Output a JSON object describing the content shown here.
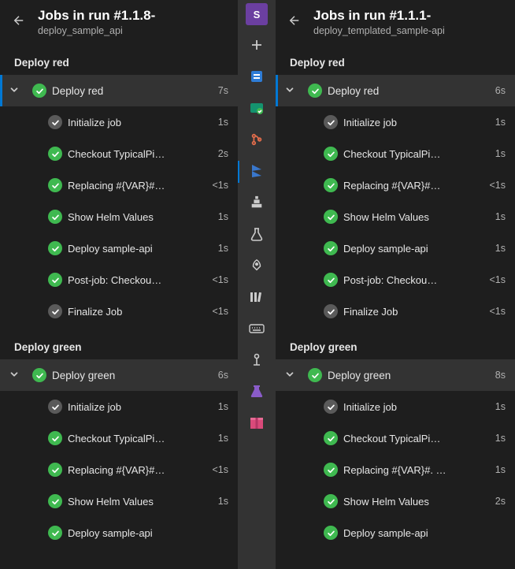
{
  "left": {
    "title": "Jobs in run #1.1.8-",
    "subtitle": "deploy_sample_api",
    "stages": [
      {
        "label": "Deploy red",
        "job": {
          "name": "Deploy red",
          "time": "7s",
          "status": "green",
          "selected": true
        },
        "steps": [
          {
            "name": "Initialize job",
            "time": "1s",
            "status": "grey"
          },
          {
            "name": "Checkout TypicalPi…",
            "time": "2s",
            "status": "green"
          },
          {
            "name": "Replacing #{VAR}#…",
            "time": "<1s",
            "status": "green"
          },
          {
            "name": "Show Helm Values",
            "time": "1s",
            "status": "green"
          },
          {
            "name": "Deploy sample-api",
            "time": "1s",
            "status": "green"
          },
          {
            "name": "Post-job: Checkou…",
            "time": "<1s",
            "status": "green"
          },
          {
            "name": "Finalize Job",
            "time": "<1s",
            "status": "grey"
          }
        ]
      },
      {
        "label": "Deploy green",
        "job": {
          "name": "Deploy green",
          "time": "6s",
          "status": "green",
          "selected": false
        },
        "steps": [
          {
            "name": "Initialize job",
            "time": "1s",
            "status": "grey"
          },
          {
            "name": "Checkout TypicalPi…",
            "time": "1s",
            "status": "green"
          },
          {
            "name": "Replacing #{VAR}#…",
            "time": "<1s",
            "status": "green"
          },
          {
            "name": "Show Helm Values",
            "time": "1s",
            "status": "green"
          },
          {
            "name": "Deploy sample-api",
            "time": "",
            "status": "green"
          }
        ]
      }
    ]
  },
  "right": {
    "title": "Jobs in run #1.1.1-",
    "subtitle": "deploy_templated_sample-api",
    "stages": [
      {
        "label": "Deploy red",
        "job": {
          "name": "Deploy red",
          "time": "6s",
          "status": "green",
          "selected": true
        },
        "steps": [
          {
            "name": "Initialize job",
            "time": "1s",
            "status": "grey"
          },
          {
            "name": "Checkout TypicalPi…",
            "time": "1s",
            "status": "green"
          },
          {
            "name": "Replacing #{VAR}#…",
            "time": "<1s",
            "status": "green"
          },
          {
            "name": "Show Helm Values",
            "time": "1s",
            "status": "green"
          },
          {
            "name": "Deploy sample-api",
            "time": "1s",
            "status": "green"
          },
          {
            "name": "Post-job: Checkou…",
            "time": "<1s",
            "status": "green"
          },
          {
            "name": "Finalize Job",
            "time": "<1s",
            "status": "grey"
          }
        ]
      },
      {
        "label": "Deploy green",
        "job": {
          "name": "Deploy green",
          "time": "8s",
          "status": "green",
          "selected": false
        },
        "steps": [
          {
            "name": "Initialize job",
            "time": "1s",
            "status": "grey"
          },
          {
            "name": "Checkout TypicalPi…",
            "time": "1s",
            "status": "green"
          },
          {
            "name": "Replacing #{VAR}#. …",
            "time": "1s",
            "status": "green"
          },
          {
            "name": "Show Helm Values",
            "time": "2s",
            "status": "green"
          },
          {
            "name": "Deploy sample-api",
            "time": "",
            "status": "green"
          }
        ]
      }
    ]
  },
  "sidebar": {
    "items": [
      {
        "name": "teams-tile",
        "color": "#6b3fa0",
        "letter": "S"
      },
      {
        "name": "add-tile"
      },
      {
        "name": "boards-tile"
      },
      {
        "name": "work-tile"
      },
      {
        "name": "repos-tile"
      },
      {
        "name": "pipelines-tile",
        "active": true
      },
      {
        "name": "environments-tile"
      },
      {
        "name": "test-plans-tile"
      },
      {
        "name": "rocket-tile"
      },
      {
        "name": "library-tile"
      },
      {
        "name": "keyboard-tile"
      },
      {
        "name": "artifacts-tile"
      },
      {
        "name": "flask-tile"
      },
      {
        "name": "package-tile"
      }
    ]
  }
}
